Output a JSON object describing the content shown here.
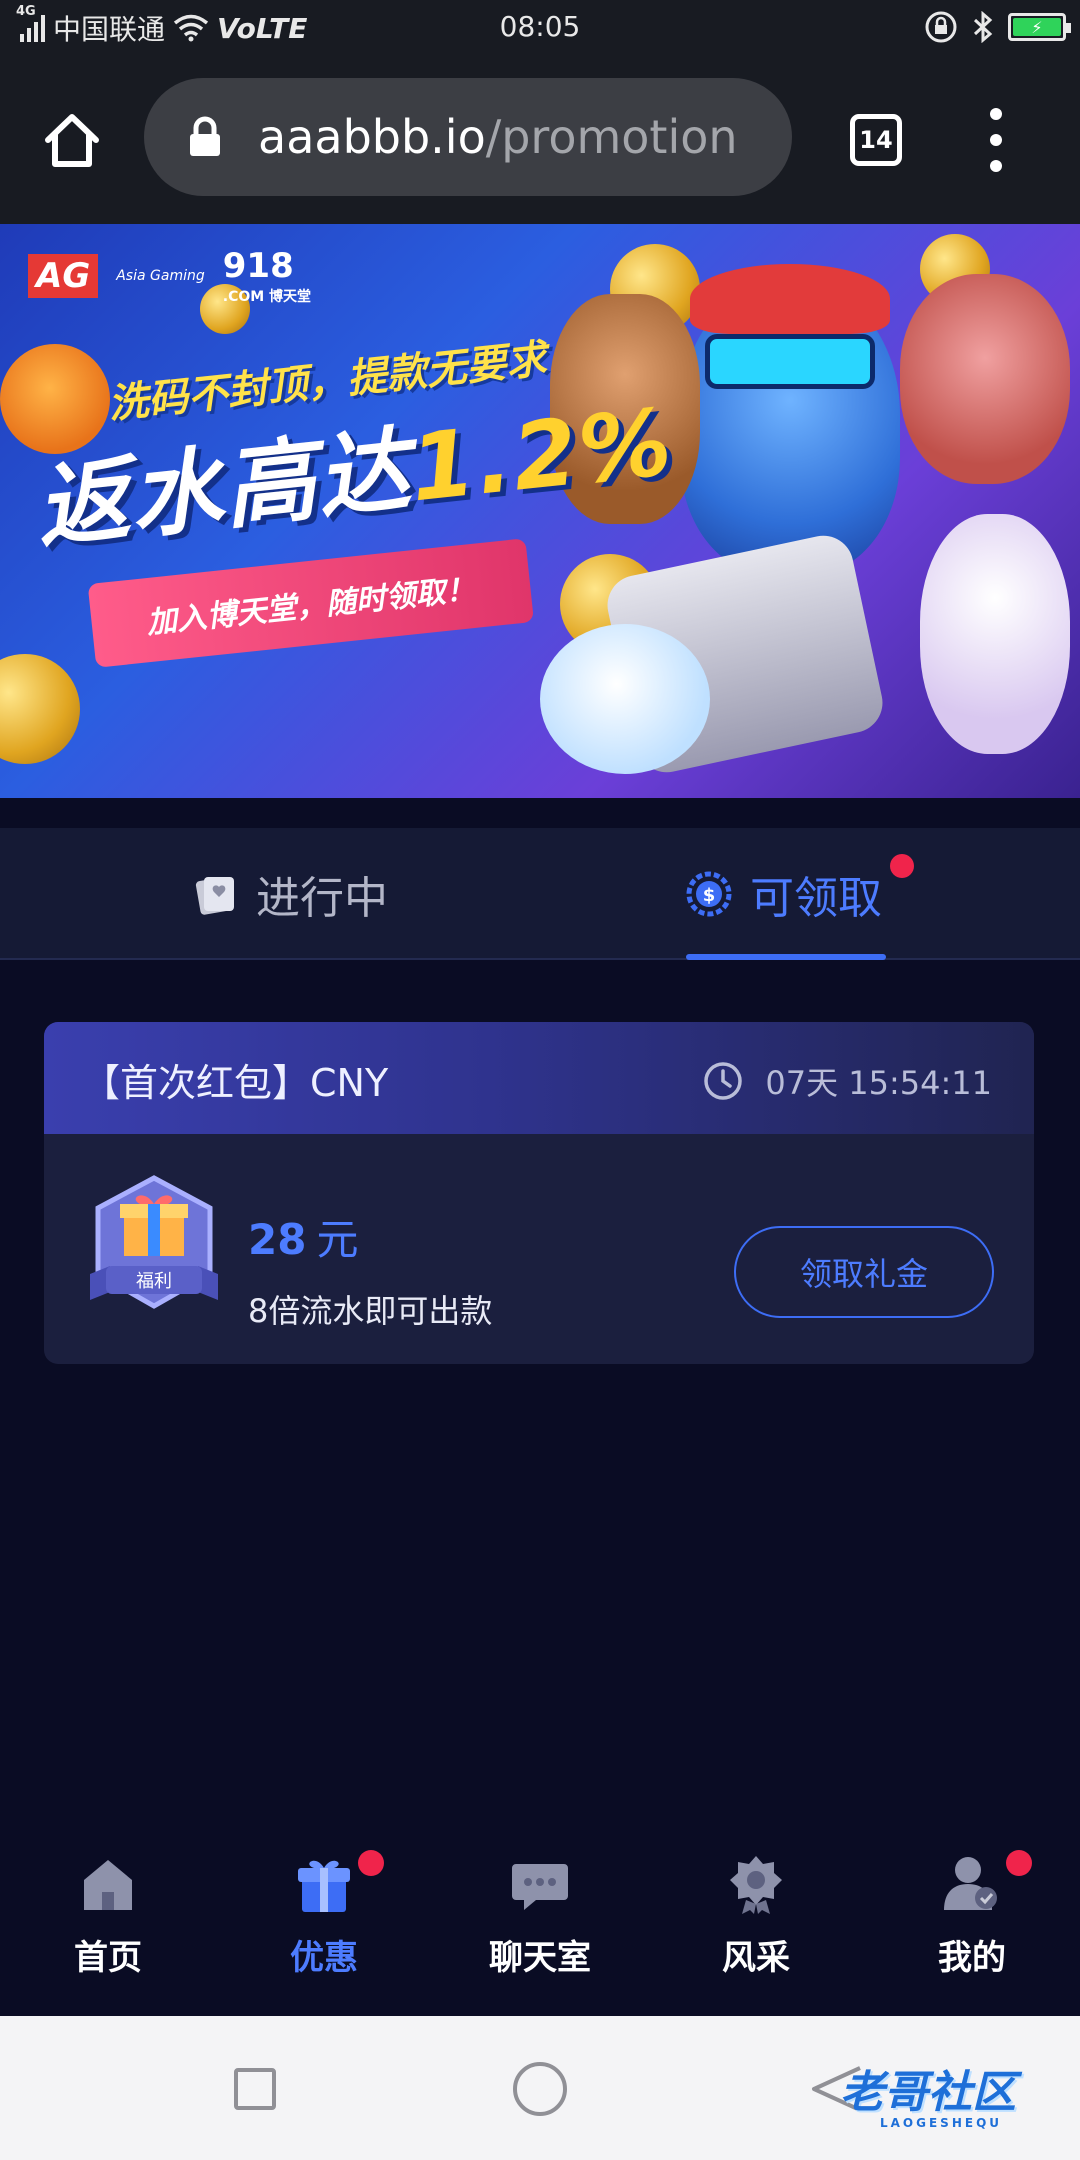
{
  "status_bar": {
    "network_type": "4G",
    "carrier": "中国联通",
    "volte": "VoLTE",
    "time": "08:05"
  },
  "browser": {
    "url_domain": "aaabbb.io",
    "url_path": "/promotion",
    "tab_count": "14"
  },
  "banner": {
    "brand_ag": "AG",
    "brand_ag_sub": "Asia Gaming",
    "brand_918": "918",
    "brand_918_sub": ".COM 博天堂",
    "line1": "洗码不封顶，提款无要求",
    "line2_main": "返水高达",
    "line2_pct": "1.2%",
    "pill_text": "加入博天堂，随时领取！"
  },
  "tabs": {
    "ongoing": "进行中",
    "claimable": "可领取"
  },
  "card": {
    "title": "【首次红包】CNY",
    "countdown": "07天 15:54:11",
    "badge_text": "福利",
    "amount": "28",
    "amount_unit": "元",
    "condition": "8倍流水即可出款",
    "claim_button": "领取礼金"
  },
  "bottom_nav": {
    "home": "首页",
    "promo": "优惠",
    "chat": "聊天室",
    "gallery": "风采",
    "mine": "我的"
  },
  "watermark": {
    "text": "老哥社区",
    "sub": "LAOGESHEQU"
  },
  "colors": {
    "accent_blue": "#4d7cff",
    "badge_red": "#f0244b",
    "page_bg": "#0a0c24"
  }
}
